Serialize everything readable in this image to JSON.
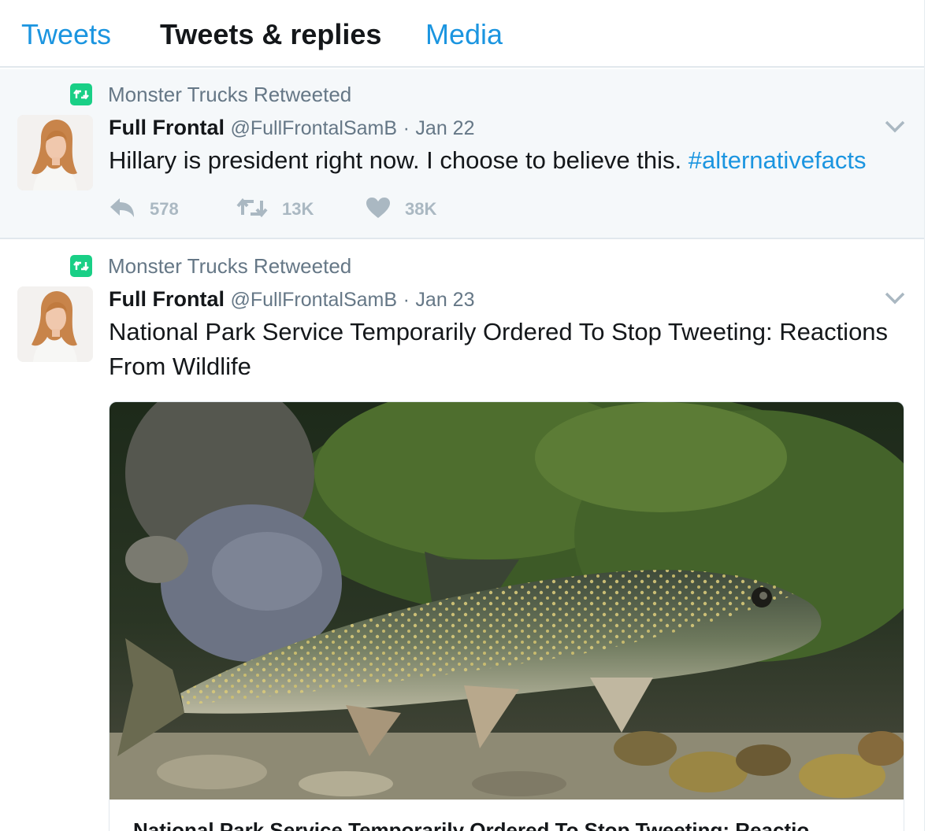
{
  "tabs": [
    "Tweets",
    "Tweets & replies",
    "Media"
  ],
  "colors": {
    "link": "#1b95e0",
    "retweet_green": "#19cf86",
    "muted": "#657786",
    "action_gray": "#aab8c2",
    "highlight_bg": "#f5f8fa"
  },
  "tweets": [
    {
      "retweeted_by": "Monster Trucks Retweeted",
      "fullname": "Full Frontal",
      "username": "@FullFrontalSamB",
      "separator": "·",
      "time": "Jan 22",
      "text": "Hillary is president right now. I choose to believe this. ",
      "hashtag": "#alternativefacts",
      "replies": "578",
      "retweets": "13K",
      "likes": "38K",
      "icons": {
        "retweet_badge": "retweet-icon",
        "reply": "reply-icon",
        "retweet": "retweet-icon",
        "like": "heart-icon",
        "menu": "chevron-down-icon"
      }
    },
    {
      "retweeted_by": "Monster Trucks Retweeted",
      "fullname": "Full Frontal",
      "username": "@FullFrontalSamB",
      "separator": "·",
      "time": "Jan 23",
      "text": "National Park Service Temporarily Ordered To Stop Tweeting: Reactions From Wildlife",
      "card": {
        "title": "National Park Service Temporarily Ordered To Stop Tweeting: Reactio"
      }
    }
  ]
}
